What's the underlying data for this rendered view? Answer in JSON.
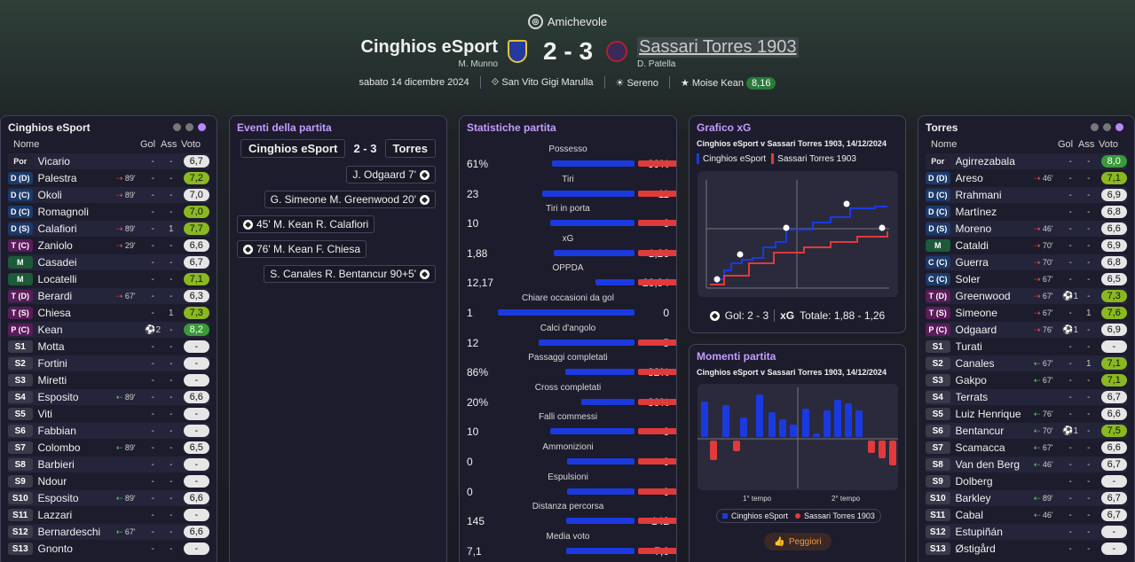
{
  "header": {
    "competition": "Amichevole",
    "home_team": "Cinghios eSport",
    "away_team": "Sassari Torres 1903",
    "score": "2 - 3",
    "home_manager": "M. Munno",
    "away_manager": "D. Patella",
    "date": "sabato 14 dicembre 2024",
    "stadium": "San Vito Gigi Marulla",
    "weather": "Sereno",
    "potm": "Moise Kean",
    "potm_rating": "8,16"
  },
  "home_panel": {
    "title": "Cinghios eSport",
    "cols": {
      "name": "Nome",
      "gol": "Gol",
      "ass": "Ass",
      "vote": "Voto"
    },
    "players": [
      {
        "pos": "Por",
        "cls": "gk",
        "name": "Vicario",
        "sub": "",
        "gol": "-",
        "ass": "-",
        "vote": "6,7",
        "vc": "v-grey"
      },
      {
        "pos": "D (D)",
        "cls": "d",
        "name": "Palestra",
        "sub": "89'",
        "gol": "-",
        "ass": "-",
        "vote": "7,2",
        "vc": "v-lime"
      },
      {
        "pos": "D (C)",
        "cls": "d",
        "name": "Okoli",
        "sub": "89'",
        "gol": "-",
        "ass": "-",
        "vote": "7,0",
        "vc": "v-grey"
      },
      {
        "pos": "D (C)",
        "cls": "d",
        "name": "Romagnoli",
        "sub": "",
        "gol": "-",
        "ass": "-",
        "vote": "7,0",
        "vc": "v-lime"
      },
      {
        "pos": "D (S)",
        "cls": "d",
        "name": "Calafiori",
        "sub": "89'",
        "gol": "-",
        "ass": "1",
        "vote": "7,7",
        "vc": "v-lime"
      },
      {
        "pos": "T (C)",
        "cls": "t",
        "name": "Zaniolo",
        "sub": "29'",
        "gol": "-",
        "ass": "-",
        "vote": "6,6",
        "vc": "v-grey"
      },
      {
        "pos": "M",
        "cls": "m",
        "name": "Casadei",
        "sub": "",
        "gol": "-",
        "ass": "-",
        "vote": "6,7",
        "vc": "v-grey"
      },
      {
        "pos": "M",
        "cls": "m",
        "name": "Locatelli",
        "sub": "",
        "gol": "-",
        "ass": "-",
        "vote": "7,1",
        "vc": "v-lime"
      },
      {
        "pos": "T (D)",
        "cls": "t",
        "name": "Berardi",
        "sub": "67'",
        "gol": "-",
        "ass": "-",
        "vote": "6,3",
        "vc": "v-grey"
      },
      {
        "pos": "T (S)",
        "cls": "t",
        "name": "Chiesa",
        "sub": "",
        "gol": "-",
        "ass": "1",
        "vote": "7,3",
        "vc": "v-lime"
      },
      {
        "pos": "P (C)",
        "cls": "t",
        "name": "Kean",
        "sub": "",
        "gol": "⚽2",
        "ass": "-",
        "vote": "8,2",
        "vc": "v-green"
      },
      {
        "pos": "S1",
        "cls": "s",
        "name": "Motta",
        "sub": "",
        "gol": "-",
        "ass": "-",
        "vote": "-",
        "vc": "v-none"
      },
      {
        "pos": "S2",
        "cls": "s",
        "name": "Fortini",
        "sub": "",
        "gol": "-",
        "ass": "-",
        "vote": "-",
        "vc": "v-none"
      },
      {
        "pos": "S3",
        "cls": "s",
        "name": "Miretti",
        "sub": "",
        "gol": "-",
        "ass": "-",
        "vote": "-",
        "vc": "v-none"
      },
      {
        "pos": "S4",
        "cls": "s",
        "name": "Esposito",
        "sub": "89'",
        "gol": "-",
        "ass": "-",
        "vote": "6,6",
        "vc": "v-grey"
      },
      {
        "pos": "S5",
        "cls": "s",
        "name": "Viti",
        "sub": "",
        "gol": "-",
        "ass": "-",
        "vote": "-",
        "vc": "v-none"
      },
      {
        "pos": "S6",
        "cls": "s",
        "name": "Fabbian",
        "sub": "",
        "gol": "-",
        "ass": "-",
        "vote": "-",
        "vc": "v-none"
      },
      {
        "pos": "S7",
        "cls": "s",
        "name": "Colombo",
        "sub": "89'",
        "gol": "-",
        "ass": "-",
        "vote": "6,5",
        "vc": "v-grey"
      },
      {
        "pos": "S8",
        "cls": "s",
        "name": "Barbieri",
        "sub": "",
        "gol": "-",
        "ass": "-",
        "vote": "-",
        "vc": "v-none"
      },
      {
        "pos": "S9",
        "cls": "s",
        "name": "Ndour",
        "sub": "",
        "gol": "-",
        "ass": "-",
        "vote": "-",
        "vc": "v-none"
      },
      {
        "pos": "S10",
        "cls": "s",
        "name": "Esposito",
        "sub": "89'",
        "gol": "-",
        "ass": "-",
        "vote": "6,6",
        "vc": "v-grey"
      },
      {
        "pos": "S11",
        "cls": "s",
        "name": "Lazzari",
        "sub": "",
        "gol": "-",
        "ass": "-",
        "vote": "-",
        "vc": "v-none"
      },
      {
        "pos": "S12",
        "cls": "s",
        "name": "Bernardeschi",
        "sub": "67'",
        "gol": "-",
        "ass": "-",
        "vote": "6,6",
        "vc": "v-grey"
      },
      {
        "pos": "S13",
        "cls": "s",
        "name": "Gnonto",
        "sub": "",
        "gol": "-",
        "ass": "-",
        "vote": "-",
        "vc": "v-none"
      }
    ]
  },
  "events": {
    "title": "Eventi della partita",
    "home": "Cinghios eSport",
    "score": "2 - 3",
    "away": "Torres",
    "items": [
      {
        "side": "away",
        "text": "J. Odgaard 7'"
      },
      {
        "side": "away",
        "text": "G. Simeone M. Greenwood 20'"
      },
      {
        "side": "home",
        "text": "45'  M. Kean R. Calafiori"
      },
      {
        "side": "home",
        "text": "76'  M. Kean F. Chiesa"
      },
      {
        "side": "away",
        "text": "S. Canales R. Bentancur 90+5'"
      }
    ]
  },
  "stats": {
    "title": "Statistiche partita",
    "items": [
      {
        "label": "Possesso",
        "l": "61%",
        "r": "39%",
        "lv": 61,
        "rv": 39
      },
      {
        "label": "Tiri",
        "l": "23",
        "r": "11",
        "lv": 23,
        "rv": 11
      },
      {
        "label": "Tiri in porta",
        "l": "10",
        "r": "6",
        "lv": 10,
        "rv": 6
      },
      {
        "label": "xG",
        "l": "1,88",
        "r": "1,26",
        "lv": 1.88,
        "rv": 1.26
      },
      {
        "label": "OPPDA",
        "l": "12,17",
        "r": "28,94",
        "lv": 12.17,
        "rv": 28.94
      },
      {
        "label": "Chiare occasioni da gol",
        "l": "1",
        "r": "0",
        "lv": 1,
        "rv": 0
      },
      {
        "label": "Calci d'angolo",
        "l": "12",
        "r": "5",
        "lv": 12,
        "rv": 5
      },
      {
        "label": "Passaggi completati",
        "l": "86%",
        "r": "82%",
        "lv": 86,
        "rv": 82
      },
      {
        "label": "Cross completati",
        "l": "20%",
        "r": "30%",
        "lv": 20,
        "rv": 30
      },
      {
        "label": "Falli commessi",
        "l": "10",
        "r": "6",
        "lv": 10,
        "rv": 6
      },
      {
        "label": "Ammonizioni",
        "l": "0",
        "r": "0",
        "lv": 1,
        "rv": 1
      },
      {
        "label": "Espulsioni",
        "l": "0",
        "r": "0",
        "lv": 1,
        "rv": 1
      },
      {
        "label": "Distanza percorsa",
        "l": "145",
        "r": "142",
        "lv": 145,
        "rv": 142
      },
      {
        "label": "Media voto",
        "l": "7,1",
        "r": "7,0",
        "lv": 7.1,
        "rv": 7.0
      }
    ]
  },
  "xg": {
    "title": "Grafico xG",
    "subtitle": "Cinghios eSport v Sassari Torres 1903, 14/12/2024",
    "legend_home": "Cinghios eSport",
    "legend_away": "Sassari Torres 1903",
    "footer_goals_label": "Gol: 2 - 3",
    "footer_xg_label": "xG",
    "footer_xg_value": "Totale: 1,88 - 1,26",
    "home_color": "#1a3ae0",
    "away_color": "#e03a3a"
  },
  "momenti": {
    "title": "Momenti partita",
    "subtitle": "Cinghios eSport v Sassari Torres 1903, 14/12/2024",
    "half1": "1° tempo",
    "half2": "2° tempo",
    "legend_home": "Cinghios eSport",
    "legend_away": "Sassari Torres 1903",
    "button": "Peggiori"
  },
  "away_panel": {
    "title": "Torres",
    "cols": {
      "name": "Nome",
      "gol": "Gol",
      "ass": "Ass",
      "vote": "Voto"
    },
    "players": [
      {
        "pos": "Por",
        "cls": "gk",
        "name": "Agirrezabala",
        "sub": "",
        "gol": "-",
        "ass": "-",
        "vote": "8,0",
        "vc": "v-green"
      },
      {
        "pos": "D (D)",
        "cls": "d",
        "name": "Areso",
        "sub": "46'",
        "gol": "-",
        "ass": "-",
        "vote": "7,1",
        "vc": "v-lime"
      },
      {
        "pos": "D (C)",
        "cls": "d",
        "name": "Rrahmani",
        "sub": "",
        "gol": "-",
        "ass": "-",
        "vote": "6,9",
        "vc": "v-grey"
      },
      {
        "pos": "D (C)",
        "cls": "d",
        "name": "Martínez",
        "sub": "",
        "gol": "-",
        "ass": "-",
        "vote": "6,8",
        "vc": "v-grey"
      },
      {
        "pos": "D (S)",
        "cls": "d",
        "name": "Moreno",
        "sub": "46'",
        "gol": "-",
        "ass": "-",
        "vote": "6,6",
        "vc": "v-grey"
      },
      {
        "pos": "M",
        "cls": "m",
        "name": "Cataldi",
        "sub": "70'",
        "gol": "-",
        "ass": "-",
        "vote": "6,9",
        "vc": "v-grey"
      },
      {
        "pos": "C (C)",
        "cls": "d",
        "name": "Guerra",
        "sub": "70'",
        "gol": "-",
        "ass": "-",
        "vote": "6,8",
        "vc": "v-grey"
      },
      {
        "pos": "C (C)",
        "cls": "d",
        "name": "Soler",
        "sub": "67'",
        "gol": "-",
        "ass": "-",
        "vote": "6,5",
        "vc": "v-grey"
      },
      {
        "pos": "T (D)",
        "cls": "t",
        "name": "Greenwood",
        "sub": "67'",
        "gol": "⚽1",
        "ass": "-",
        "vote": "7,3",
        "vc": "v-lime"
      },
      {
        "pos": "T (S)",
        "cls": "t",
        "name": "Simeone",
        "sub": "67'",
        "gol": "-",
        "ass": "1",
        "vote": "7,6",
        "vc": "v-lime"
      },
      {
        "pos": "P (C)",
        "cls": "t",
        "name": "Odgaard",
        "sub": "76'",
        "gol": "⚽1",
        "ass": "-",
        "vote": "6,9",
        "vc": "v-grey"
      },
      {
        "pos": "S1",
        "cls": "s",
        "name": "Turati",
        "sub": "",
        "gol": "-",
        "ass": "-",
        "vote": "-",
        "vc": "v-none"
      },
      {
        "pos": "S2",
        "cls": "s",
        "name": "Canales",
        "sub": "67'",
        "gol": "-",
        "ass": "1",
        "vote": "7,1",
        "vc": "v-lime"
      },
      {
        "pos": "S3",
        "cls": "s",
        "name": "Gakpo",
        "sub": "67'",
        "gol": "-",
        "ass": "-",
        "vote": "7,1",
        "vc": "v-lime"
      },
      {
        "pos": "S4",
        "cls": "s",
        "name": "Terrats",
        "sub": "",
        "gol": "-",
        "ass": "-",
        "vote": "6,7",
        "vc": "v-grey"
      },
      {
        "pos": "S5",
        "cls": "s",
        "name": "Luiz Henrique",
        "sub": "76'",
        "gol": "-",
        "ass": "-",
        "vote": "6,6",
        "vc": "v-grey"
      },
      {
        "pos": "S6",
        "cls": "s",
        "name": "Bentancur",
        "sub": "70'",
        "gol": "⚽1",
        "ass": "-",
        "vote": "7,5",
        "vc": "v-lime"
      },
      {
        "pos": "S7",
        "cls": "s",
        "name": "Scamacca",
        "sub": "67'",
        "gol": "-",
        "ass": "-",
        "vote": "6,6",
        "vc": "v-grey"
      },
      {
        "pos": "S8",
        "cls": "s",
        "name": "Van den Berg",
        "sub": "46'",
        "gol": "-",
        "ass": "-",
        "vote": "6,7",
        "vc": "v-grey"
      },
      {
        "pos": "S9",
        "cls": "s",
        "name": "Dolberg",
        "sub": "",
        "gol": "-",
        "ass": "-",
        "vote": "-",
        "vc": "v-none"
      },
      {
        "pos": "S10",
        "cls": "s",
        "name": "Barkley",
        "sub": "89'",
        "gol": "-",
        "ass": "-",
        "vote": "6,7",
        "vc": "v-grey"
      },
      {
        "pos": "S11",
        "cls": "s",
        "name": "Cabal",
        "sub": "46'",
        "gol": "-",
        "ass": "-",
        "vote": "6,7",
        "vc": "v-grey"
      },
      {
        "pos": "S12",
        "cls": "s",
        "name": "Estupiñán",
        "sub": "",
        "gol": "-",
        "ass": "-",
        "vote": "-",
        "vc": "v-none"
      },
      {
        "pos": "S13",
        "cls": "s",
        "name": "Østigård",
        "sub": "",
        "gol": "-",
        "ass": "-",
        "vote": "-",
        "vc": "v-none"
      }
    ]
  }
}
